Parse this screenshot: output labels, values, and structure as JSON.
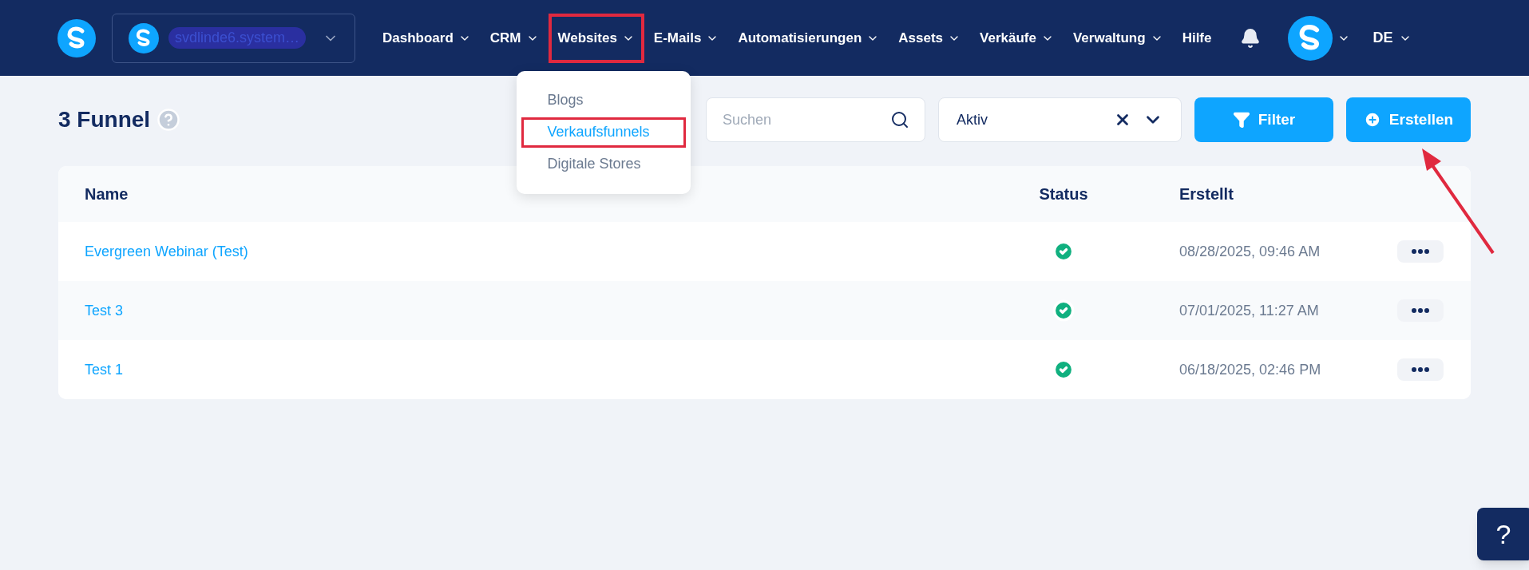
{
  "nav": {
    "workspace": "svdlinde6.system…",
    "items": [
      {
        "label": "Dashboard",
        "selected": false,
        "has_menu": true
      },
      {
        "label": "CRM",
        "selected": false,
        "has_menu": true
      },
      {
        "label": "Websites",
        "selected": true,
        "has_menu": true
      },
      {
        "label": "E-Mails",
        "selected": false,
        "has_menu": true
      },
      {
        "label": "Automatisierungen",
        "selected": false,
        "has_menu": true
      },
      {
        "label": "Assets",
        "selected": false,
        "has_menu": true
      },
      {
        "label": "Verkäufe",
        "selected": false,
        "has_menu": true
      },
      {
        "label": "Verwaltung",
        "selected": false,
        "has_menu": true
      },
      {
        "label": "Hilfe",
        "selected": false,
        "has_menu": false
      }
    ],
    "language": "DE",
    "menu": [
      {
        "label": "Blogs",
        "selected": false
      },
      {
        "label": "Verkaufsfunnels",
        "selected": true
      },
      {
        "label": "Digitale Stores",
        "selected": false
      }
    ]
  },
  "page": {
    "title": "3 Funnel",
    "search": {
      "placeholder": "Suchen"
    },
    "status_filter": {
      "value": "Aktiv"
    },
    "buttons": [
      {
        "kind": "filter",
        "label": "Filter"
      },
      {
        "kind": "create",
        "label": "Erstellen"
      }
    ]
  },
  "table": {
    "columns": [
      "Name",
      "Status",
      "Erstellt"
    ],
    "rows": [
      {
        "name": "Evergreen Webinar (Test)",
        "active": true,
        "created": "08/28/2025, 09:46 AM"
      },
      {
        "name": "Test 3",
        "active": true,
        "created": "07/01/2025, 11:27 AM"
      },
      {
        "name": "Test 1",
        "active": true,
        "created": "06/18/2025, 02:46 PM"
      }
    ]
  },
  "help_button": "?"
}
